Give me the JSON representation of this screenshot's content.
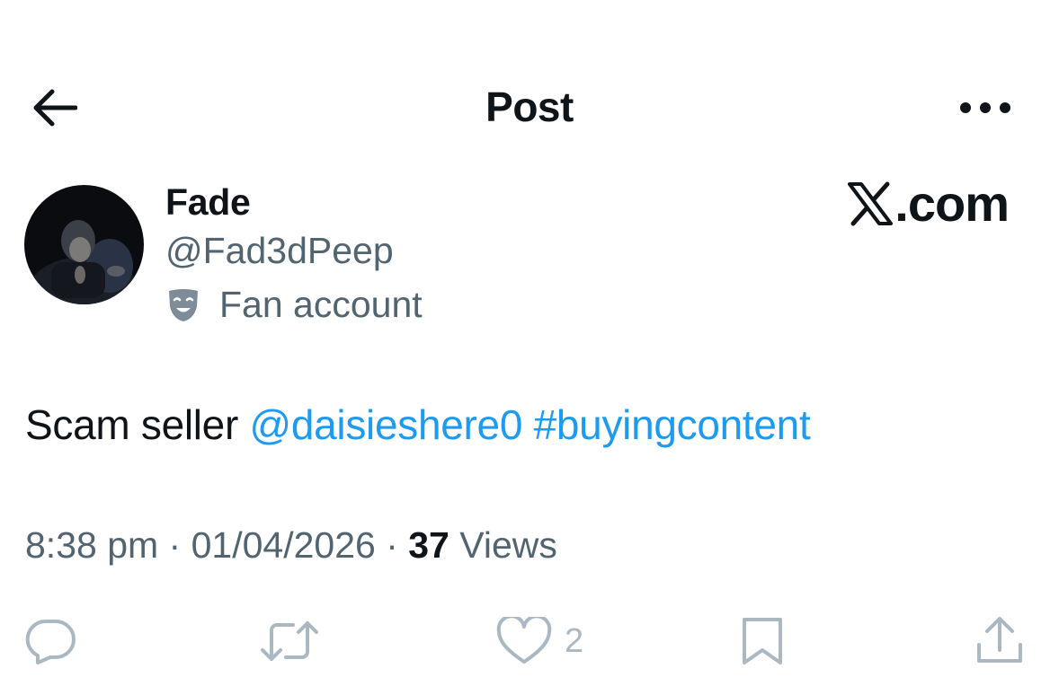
{
  "header": {
    "back_icon": "arrow-left-icon",
    "title": "Post",
    "more_icon": "more-horizontal-icon"
  },
  "author": {
    "display_name": "Fade",
    "handle": "@Fad3dPeep",
    "label_icon": "theater-mask-icon",
    "label": "Fan account"
  },
  "watermark": {
    "logo_icon": "x-logo-icon",
    "suffix": ".com"
  },
  "tweet": {
    "text": "Scam seller ",
    "mention": "@daisieshere0",
    "space": " ",
    "hashtag": "#buyingcontent"
  },
  "meta": {
    "time": "8:38 pm",
    "date": "01/04/2026",
    "views_count": "37",
    "views_label": "Views",
    "separator": " · "
  },
  "actions": {
    "reply_icon": "reply-icon",
    "repost_icon": "repost-icon",
    "like_icon": "heart-icon",
    "like_count": "2",
    "bookmark_icon": "bookmark-icon",
    "share_icon": "share-icon"
  },
  "colors": {
    "text": "#0f1419",
    "secondary": "#536471",
    "link": "#1d9bf0",
    "action_icon": "#aab8c2"
  }
}
